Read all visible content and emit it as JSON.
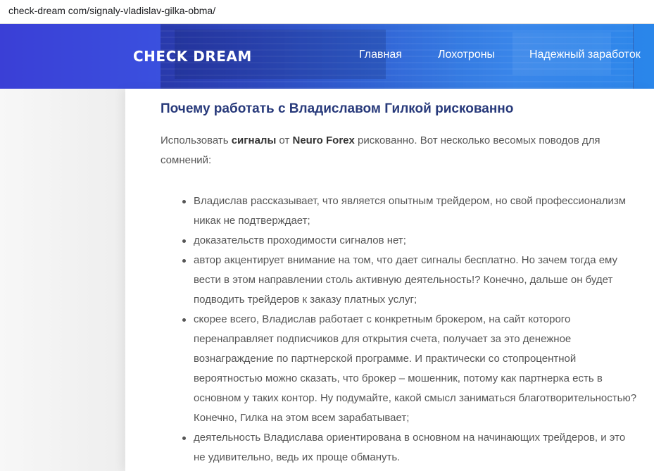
{
  "browser": {
    "url": "check-dream com/signaly-vladislav-gilka-obma/"
  },
  "header": {
    "logo": "CHECK DREAM",
    "nav": [
      {
        "label": "Главная"
      },
      {
        "label": "Лохотроны"
      },
      {
        "label": "Надежный заработок"
      }
    ],
    "colors": {
      "gradient_start": "#3a3fd6",
      "gradient_end": "#2a86ea"
    }
  },
  "article": {
    "title": "Почему работать с Владиславом Гилкой рискованно",
    "intro": {
      "part1": "Использовать ",
      "bold1": "сигналы",
      "part2": " от ",
      "bold2": "Neuro Forex",
      "part3": " рискованно. Вот несколько весомых поводов для сомнений:"
    },
    "items": [
      "Владислав рассказывает, что является опытным трейдером, но свой профессионализм никак не подтверждает;",
      "доказательств проходимости сигналов нет;",
      "автор акцентирует внимание на том, что дает сигналы бесплатно. Но зачем тогда ему вести в этом направлении столь активную деятельность!? Конечно, дальше он будет подводить трейдеров к заказу платных услуг;",
      "скорее всего, Владислав работает с конкретным брокером, на сайт которого перенаправляет подписчиков для открытия счета, получает за это денежное вознаграждение по партнерской программе. И практически со стопроцентной вероятностью можно сказать, что брокер – мошенник, потому как партнерка есть в основном у таких контор. Ну подумайте, какой смысл заниматься благотворительностью? Конечно, Гилка на этом всем зарабатывает;",
      "деятельность Владислава ориентирована в основном на начинающих трейдеров, и это не удивительно, ведь их проще обмануть."
    ],
    "title_color": "#27397a"
  }
}
